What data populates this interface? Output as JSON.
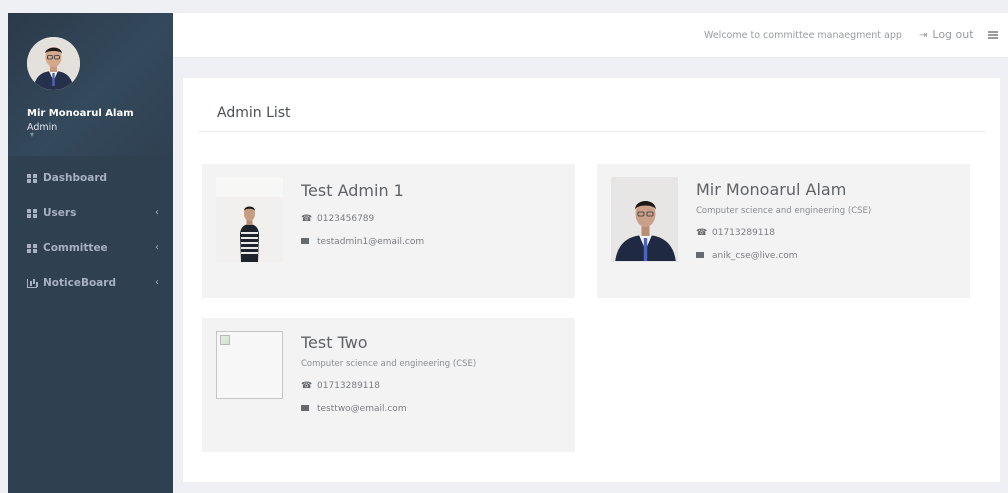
{
  "sidebar": {
    "profile": {
      "name": "Mir Monoarul Alam",
      "role": "Admin",
      "caret": "▾"
    },
    "items": [
      {
        "label": "Dashboard",
        "icon": "grid-icon",
        "has_submenu": false
      },
      {
        "label": "Users",
        "icon": "grid-icon",
        "has_submenu": true
      },
      {
        "label": "Committee",
        "icon": "grid-icon",
        "has_submenu": true
      },
      {
        "label": "NoticeBoard",
        "icon": "bar-chart-icon",
        "has_submenu": true
      }
    ],
    "submenu_arrow": "‹"
  },
  "topbar": {
    "welcome": "Welcome to committee manaegment app",
    "logout_label": "Log out",
    "logout_icon": "⇥"
  },
  "main": {
    "title": "Admin List",
    "admins": [
      {
        "name": "Test Admin 1",
        "department": "",
        "phone": "0123456789",
        "email": "testadmin1@email.com",
        "photo": "striped-sweater-man"
      },
      {
        "name": "Mir Monoarul Alam",
        "department": "Computer science and engineering (CSE)",
        "phone": "01713289118",
        "email": "anik_cse@live.com",
        "photo": "suit-man"
      },
      {
        "name": "Test Two",
        "department": "Computer science and engineering (CSE)",
        "phone": "01713289118",
        "email": "testtwo@email.com",
        "photo": "broken-image"
      }
    ]
  },
  "colors": {
    "sidebar_bg": "#2f4050",
    "sidebar_text": "#a7b1c2",
    "page_bg": "#eef0f4",
    "card_bg": "#f3f3f4"
  }
}
